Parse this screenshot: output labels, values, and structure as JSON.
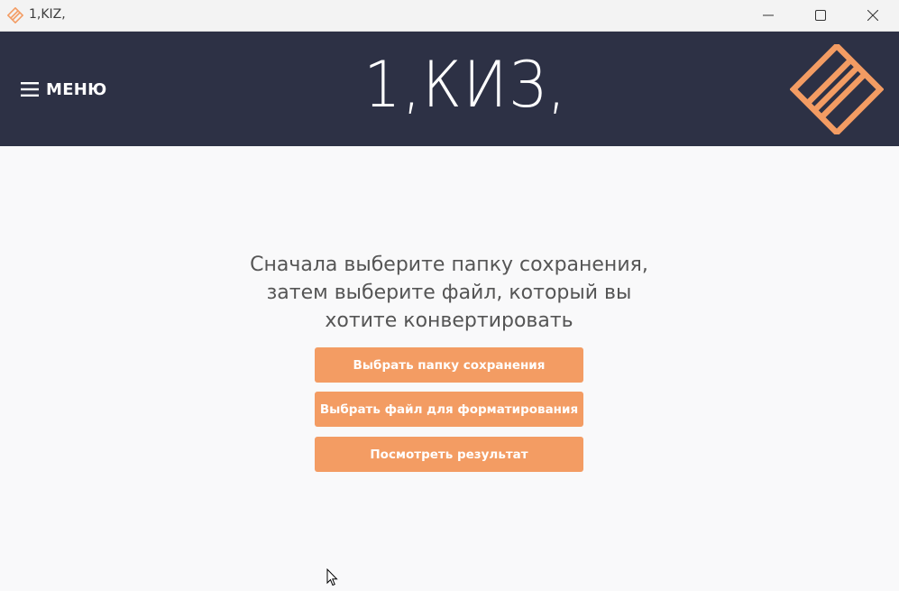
{
  "window": {
    "title": "1,KIZ,"
  },
  "header": {
    "menu_label": "МЕНЮ",
    "logo_text": "1,КИЗ,"
  },
  "main": {
    "instruction_lines": [
      "Сначала выберите папку сохранения,",
      "затем выберите файл, который вы",
      "хотите конвертировать"
    ],
    "buttons": [
      "Выбрать папку сохранения",
      "Выбрать файл для форматирования",
      "Посмотреть результат"
    ]
  },
  "colors": {
    "header_bg": "#2d3145",
    "accent": "#f39c63",
    "page_bg": "#f9f9fa"
  },
  "icons": {
    "app_icon": "diamond-stripes-logo-icon",
    "menu_icon": "hamburger-menu-icon",
    "minimize_icon": "minimize-icon",
    "maximize_icon": "maximize-icon",
    "close_icon": "close-icon"
  }
}
